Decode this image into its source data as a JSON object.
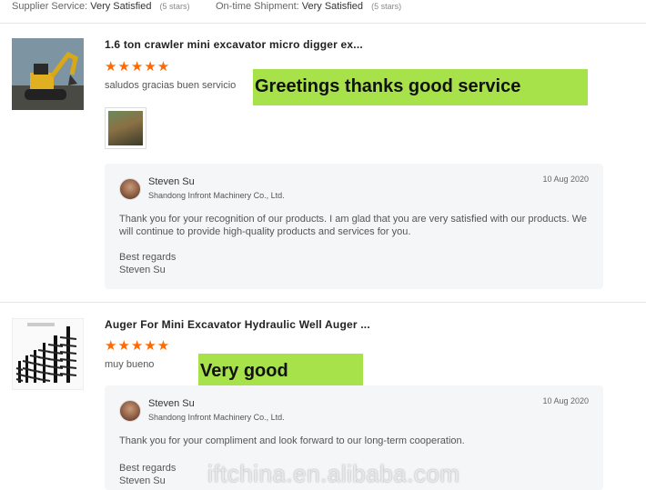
{
  "summary": {
    "supplier_service_label": "Supplier Service:",
    "supplier_service_value": "Very Satisfied",
    "supplier_service_stars": "(5 stars)",
    "shipment_label": "On-time Shipment:",
    "shipment_value": "Very Satisfied",
    "shipment_stars": "(5 stars)"
  },
  "reviews": [
    {
      "product_title": "1.6 ton crawler mini excavator micro digger ex...",
      "stars": "★★★★★",
      "rating": 5,
      "comment": "saludos gracias buen servicio",
      "translation": "Greetings thanks good service",
      "reply": {
        "name": "Steven Su",
        "company": "Shandong Infront Machinery Co., Ltd.",
        "date": "10 Aug 2020",
        "message": "Thank you for your recognition of our products. I am glad that you are very satisfied with our products. We will continue to provide high-quality products and services for you.",
        "regards": "Best regards",
        "signature": "Steven Su"
      }
    },
    {
      "product_title": "Auger For Mini Excavator Hydraulic Well Auger ...",
      "stars": "★★★★★",
      "rating": 5,
      "comment": "muy bueno",
      "translation": "Very good",
      "reply": {
        "name": "Steven Su",
        "company": "Shandong Infront Machinery Co., Ltd.",
        "date": "10 Aug 2020",
        "message": "Thank you for your compliment and look forward to our long-term cooperation.",
        "regards": "Best regards",
        "signature": "Steven Su"
      }
    }
  ],
  "watermark": "iftchina.en.alibaba.com",
  "colors": {
    "star": "#ff6a00",
    "highlight": "#a8e24a",
    "reply_bg": "#f5f6f8"
  }
}
